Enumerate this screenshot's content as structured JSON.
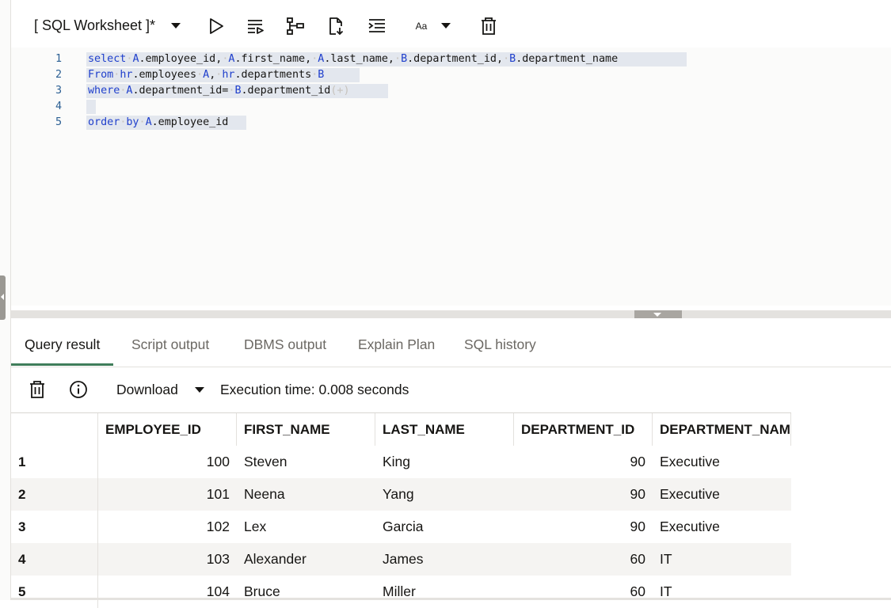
{
  "toolbar": {
    "title": "[ SQL Worksheet ]*",
    "font_label": "Aa",
    "icons": [
      "run-statement-icon",
      "run-script-icon",
      "explain-plan-icon",
      "autotrace-icon",
      "format-icon",
      "font-case-icon",
      "clear-icon"
    ]
  },
  "editor": {
    "lines": [
      {
        "n": "1",
        "text": "select A.employee_id, A.first_name, A.last_name, B.department_id, B.department_name"
      },
      {
        "n": "2",
        "text": "From hr.employees A, hr.departments B"
      },
      {
        "n": "3",
        "text": "where A.department_id= B.department_id(+)"
      },
      {
        "n": "4",
        "text": ""
      },
      {
        "n": "5",
        "text": "order by A.employee_id"
      }
    ]
  },
  "tabs": [
    {
      "label": "Query result",
      "active": true
    },
    {
      "label": "Script output",
      "active": false
    },
    {
      "label": "DBMS output",
      "active": false
    },
    {
      "label": "Explain Plan",
      "active": false
    },
    {
      "label": "SQL history",
      "active": false
    }
  ],
  "results_toolbar": {
    "download_label": "Download",
    "execution_time": "Execution time: 0.008 seconds"
  },
  "grid": {
    "columns": [
      "EMPLOYEE_ID",
      "FIRST_NAME",
      "LAST_NAME",
      "DEPARTMENT_ID",
      "DEPARTMENT_NAM"
    ],
    "rows": [
      {
        "row": "1",
        "employee_id": "100",
        "first_name": "Steven",
        "last_name": "King",
        "department_id": "90",
        "department_name": "Executive"
      },
      {
        "row": "2",
        "employee_id": "101",
        "first_name": "Neena",
        "last_name": "Yang",
        "department_id": "90",
        "department_name": "Executive"
      },
      {
        "row": "3",
        "employee_id": "102",
        "first_name": "Lex",
        "last_name": "Garcia",
        "department_id": "90",
        "department_name": "Executive"
      },
      {
        "row": "4",
        "employee_id": "103",
        "first_name": "Alexander",
        "last_name": "James",
        "department_id": "60",
        "department_name": "IT"
      },
      {
        "row": "5",
        "employee_id": "104",
        "first_name": "Bruce",
        "last_name": "Miller",
        "department_id": "60",
        "department_name": "IT"
      }
    ]
  },
  "colors": {
    "keyword": "#1f3fcc",
    "line_number": "#2b5f93",
    "active_tab": "#3f7d5a",
    "selection": "#e3e7ee"
  }
}
